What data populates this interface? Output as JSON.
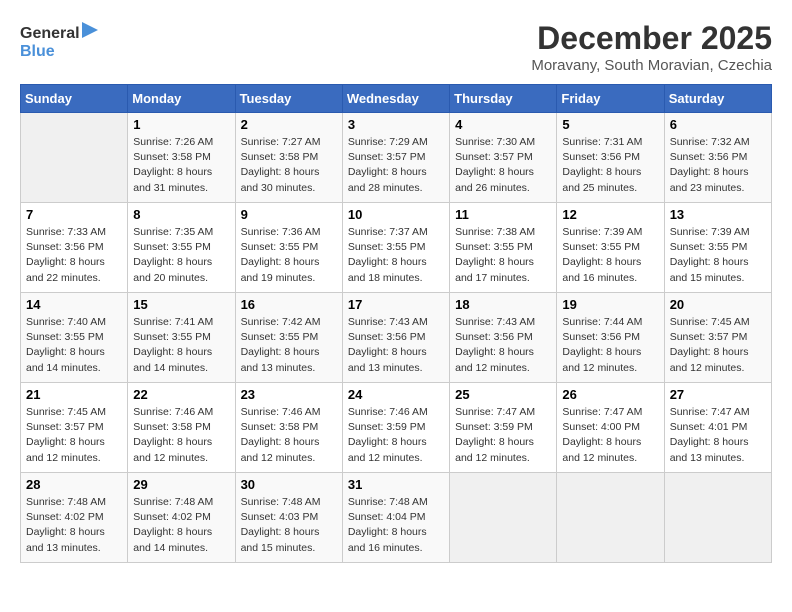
{
  "header": {
    "logo_line1": "General",
    "logo_line2": "Blue",
    "month_title": "December 2025",
    "location": "Moravany, South Moravian, Czechia"
  },
  "weekdays": [
    "Sunday",
    "Monday",
    "Tuesday",
    "Wednesday",
    "Thursday",
    "Friday",
    "Saturday"
  ],
  "weeks": [
    [
      {
        "num": "",
        "info": ""
      },
      {
        "num": "1",
        "info": "Sunrise: 7:26 AM\nSunset: 3:58 PM\nDaylight: 8 hours\nand 31 minutes."
      },
      {
        "num": "2",
        "info": "Sunrise: 7:27 AM\nSunset: 3:58 PM\nDaylight: 8 hours\nand 30 minutes."
      },
      {
        "num": "3",
        "info": "Sunrise: 7:29 AM\nSunset: 3:57 PM\nDaylight: 8 hours\nand 28 minutes."
      },
      {
        "num": "4",
        "info": "Sunrise: 7:30 AM\nSunset: 3:57 PM\nDaylight: 8 hours\nand 26 minutes."
      },
      {
        "num": "5",
        "info": "Sunrise: 7:31 AM\nSunset: 3:56 PM\nDaylight: 8 hours\nand 25 minutes."
      },
      {
        "num": "6",
        "info": "Sunrise: 7:32 AM\nSunset: 3:56 PM\nDaylight: 8 hours\nand 23 minutes."
      }
    ],
    [
      {
        "num": "7",
        "info": "Sunrise: 7:33 AM\nSunset: 3:56 PM\nDaylight: 8 hours\nand 22 minutes."
      },
      {
        "num": "8",
        "info": "Sunrise: 7:35 AM\nSunset: 3:55 PM\nDaylight: 8 hours\nand 20 minutes."
      },
      {
        "num": "9",
        "info": "Sunrise: 7:36 AM\nSunset: 3:55 PM\nDaylight: 8 hours\nand 19 minutes."
      },
      {
        "num": "10",
        "info": "Sunrise: 7:37 AM\nSunset: 3:55 PM\nDaylight: 8 hours\nand 18 minutes."
      },
      {
        "num": "11",
        "info": "Sunrise: 7:38 AM\nSunset: 3:55 PM\nDaylight: 8 hours\nand 17 minutes."
      },
      {
        "num": "12",
        "info": "Sunrise: 7:39 AM\nSunset: 3:55 PM\nDaylight: 8 hours\nand 16 minutes."
      },
      {
        "num": "13",
        "info": "Sunrise: 7:39 AM\nSunset: 3:55 PM\nDaylight: 8 hours\nand 15 minutes."
      }
    ],
    [
      {
        "num": "14",
        "info": "Sunrise: 7:40 AM\nSunset: 3:55 PM\nDaylight: 8 hours\nand 14 minutes."
      },
      {
        "num": "15",
        "info": "Sunrise: 7:41 AM\nSunset: 3:55 PM\nDaylight: 8 hours\nand 14 minutes."
      },
      {
        "num": "16",
        "info": "Sunrise: 7:42 AM\nSunset: 3:55 PM\nDaylight: 8 hours\nand 13 minutes."
      },
      {
        "num": "17",
        "info": "Sunrise: 7:43 AM\nSunset: 3:56 PM\nDaylight: 8 hours\nand 13 minutes."
      },
      {
        "num": "18",
        "info": "Sunrise: 7:43 AM\nSunset: 3:56 PM\nDaylight: 8 hours\nand 12 minutes."
      },
      {
        "num": "19",
        "info": "Sunrise: 7:44 AM\nSunset: 3:56 PM\nDaylight: 8 hours\nand 12 minutes."
      },
      {
        "num": "20",
        "info": "Sunrise: 7:45 AM\nSunset: 3:57 PM\nDaylight: 8 hours\nand 12 minutes."
      }
    ],
    [
      {
        "num": "21",
        "info": "Sunrise: 7:45 AM\nSunset: 3:57 PM\nDaylight: 8 hours\nand 12 minutes."
      },
      {
        "num": "22",
        "info": "Sunrise: 7:46 AM\nSunset: 3:58 PM\nDaylight: 8 hours\nand 12 minutes."
      },
      {
        "num": "23",
        "info": "Sunrise: 7:46 AM\nSunset: 3:58 PM\nDaylight: 8 hours\nand 12 minutes."
      },
      {
        "num": "24",
        "info": "Sunrise: 7:46 AM\nSunset: 3:59 PM\nDaylight: 8 hours\nand 12 minutes."
      },
      {
        "num": "25",
        "info": "Sunrise: 7:47 AM\nSunset: 3:59 PM\nDaylight: 8 hours\nand 12 minutes."
      },
      {
        "num": "26",
        "info": "Sunrise: 7:47 AM\nSunset: 4:00 PM\nDaylight: 8 hours\nand 12 minutes."
      },
      {
        "num": "27",
        "info": "Sunrise: 7:47 AM\nSunset: 4:01 PM\nDaylight: 8 hours\nand 13 minutes."
      }
    ],
    [
      {
        "num": "28",
        "info": "Sunrise: 7:48 AM\nSunset: 4:02 PM\nDaylight: 8 hours\nand 13 minutes."
      },
      {
        "num": "29",
        "info": "Sunrise: 7:48 AM\nSunset: 4:02 PM\nDaylight: 8 hours\nand 14 minutes."
      },
      {
        "num": "30",
        "info": "Sunrise: 7:48 AM\nSunset: 4:03 PM\nDaylight: 8 hours\nand 15 minutes."
      },
      {
        "num": "31",
        "info": "Sunrise: 7:48 AM\nSunset: 4:04 PM\nDaylight: 8 hours\nand 16 minutes."
      },
      {
        "num": "",
        "info": ""
      },
      {
        "num": "",
        "info": ""
      },
      {
        "num": "",
        "info": ""
      }
    ]
  ]
}
